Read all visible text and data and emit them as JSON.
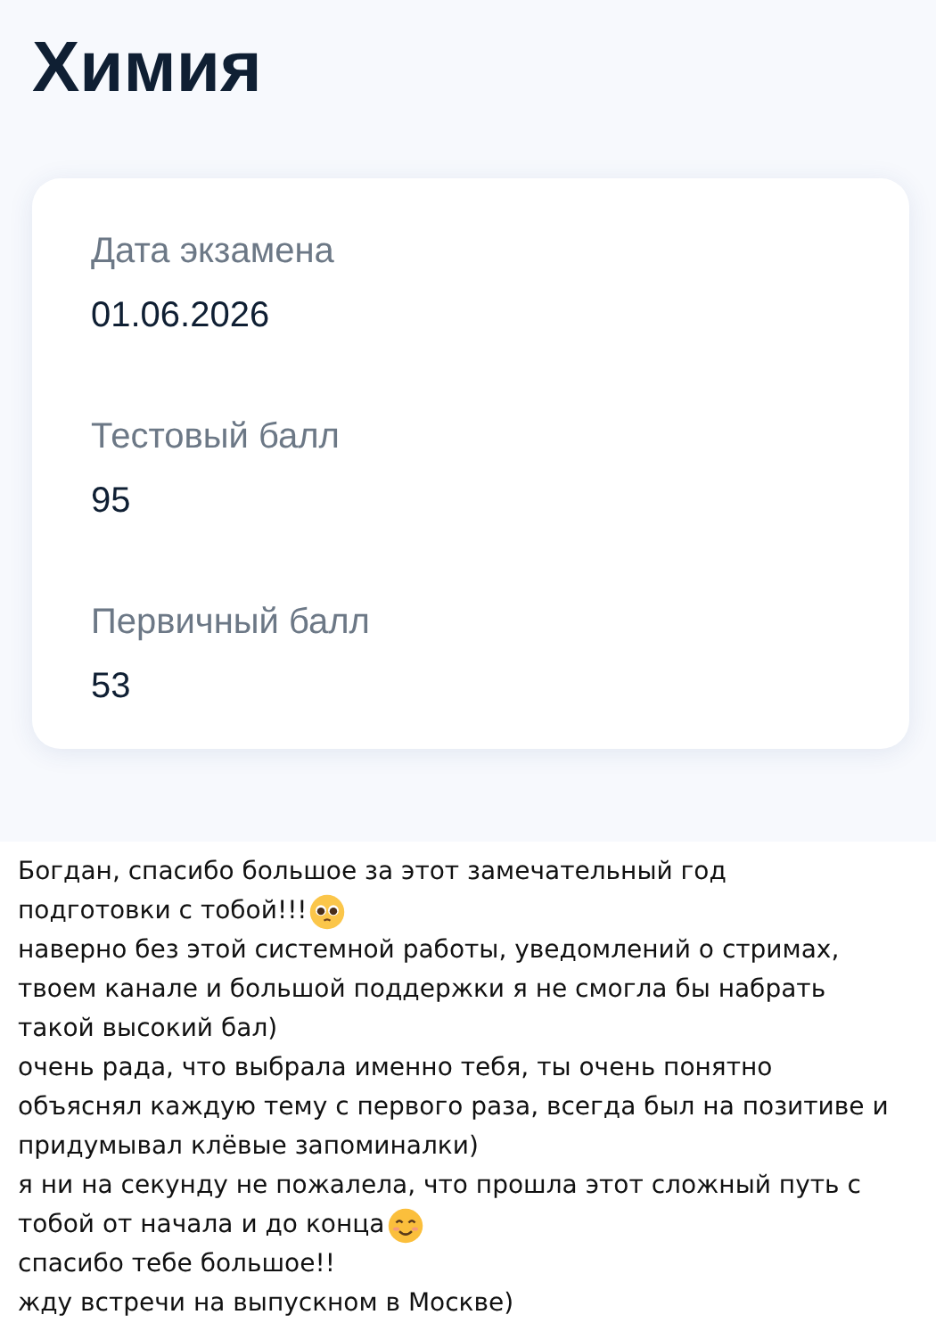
{
  "title": "Химия",
  "fields": [
    {
      "label": "Дата экзамена",
      "value": "01.06.2026"
    },
    {
      "label": "Тестовый балл",
      "value": "95"
    },
    {
      "label": "Первичный балл",
      "value": "53"
    }
  ],
  "message_lines": [
    {
      "text": "Богдан, спасибо большое за этот замечательный год"
    },
    {
      "text": "подготовки с тобой!!!",
      "kind": "pleading"
    },
    {
      "text": "наверно без этой системной работы, уведомлений о стримах,"
    },
    {
      "text": "твоем канале и большой поддержки я не смогла бы набрать"
    },
    {
      "text": "такой высокий бал)"
    },
    {
      "text": "очень рада, что выбрала именно тебя, ты очень понятно"
    },
    {
      "text": "объяснял каждую тему с первого раза, всегда был на позитиве и"
    },
    {
      "text": "придумывал клёвые запоминалки)"
    },
    {
      "text": "я ни на секунду не пожалела, что прошла этот сложный путь с"
    },
    {
      "text": "тобой от начала и до конца",
      "kind": "smiling"
    },
    {
      "text": "спасибо тебе большое!!"
    },
    {
      "text": "жду встречи на выпускном в Москве)"
    }
  ]
}
